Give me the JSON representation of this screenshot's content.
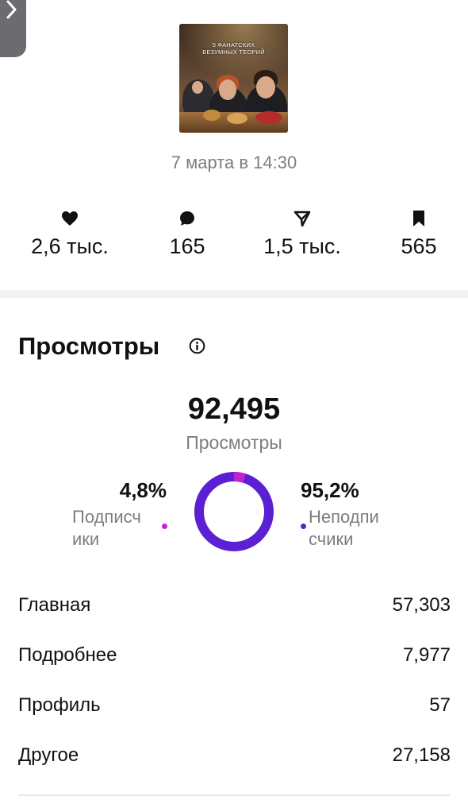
{
  "post": {
    "thumbnail_caption": "5 ФАНАТСКИХ\nБЕЗУМНЫХ ТЕОРИЙ",
    "date": "7 марта в 14:30"
  },
  "stats": [
    {
      "icon": "heart-icon",
      "value": "2,6 тыс."
    },
    {
      "icon": "comment-icon",
      "value": "165"
    },
    {
      "icon": "share-icon",
      "value": "1,5 тыс."
    },
    {
      "icon": "bookmark-icon",
      "value": "565"
    }
  ],
  "views": {
    "title": "Просмотры",
    "total": "92,495",
    "total_label": "Просмотры",
    "followers_pct": "4,8%",
    "followers_label": "Подписч\nики",
    "non_followers_pct": "95,2%",
    "non_followers_label": "Неподпи\nсчики",
    "donut_followers_fraction": 0.048,
    "colors": {
      "followers": "#c41fcf",
      "non_followers": "#5b1fd4"
    }
  },
  "sources": [
    {
      "name": "Главная",
      "value": "57,303"
    },
    {
      "name": "Подробнее",
      "value": "7,977"
    },
    {
      "name": "Профиль",
      "value": "57"
    },
    {
      "name": "Другое",
      "value": "27,158"
    }
  ]
}
